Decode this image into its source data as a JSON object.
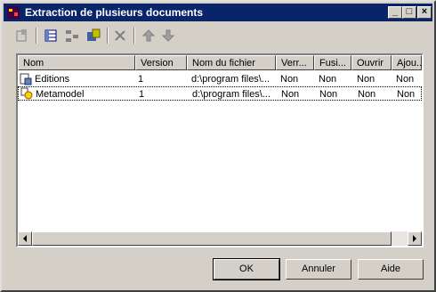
{
  "window": {
    "title": "Extraction de plusieurs documents"
  },
  "icons": [
    "properties-icon",
    "add-columns-icon",
    "reorder-icon",
    "add-from-repository-icon",
    "delete-icon",
    "move-up-icon",
    "move-down-icon"
  ],
  "list": {
    "columns": [
      "Nom",
      "Version",
      "Nom du fichier",
      "Verr...",
      "Fusi...",
      "Ouvrir",
      "Ajou..."
    ],
    "rows": [
      {
        "name": "Editions",
        "version": "1",
        "file": "d:\\program files\\...",
        "lock": "Non",
        "merge": "Non",
        "open": "Non",
        "add": "Non"
      },
      {
        "name": "Metamodel",
        "version": "1",
        "file": "d:\\program files\\...",
        "lock": "Non",
        "merge": "Non",
        "open": "Non",
        "add": "Non"
      }
    ]
  },
  "buttons": {
    "ok": "OK",
    "cancel": "Annuler",
    "help": "Aide"
  },
  "colors": {
    "titlebar": "#0a246a",
    "face": "#d4d0c8"
  }
}
